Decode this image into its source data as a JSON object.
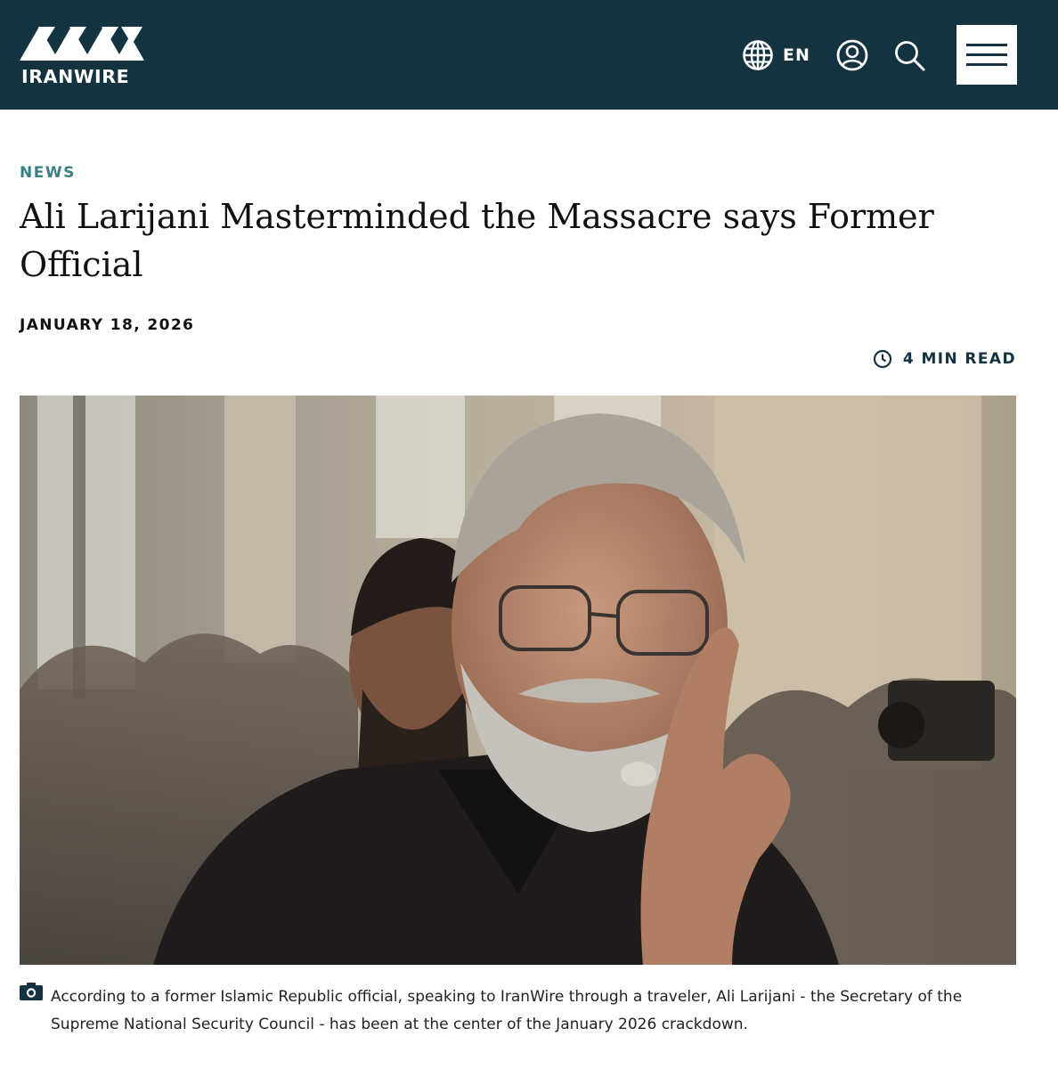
{
  "header": {
    "brand": "IRANWIRE",
    "language": "EN",
    "colors": {
      "bar": "#143340",
      "accent": "#3a7f83"
    },
    "icons": [
      "globe-icon",
      "user-icon",
      "search-icon",
      "hamburger-menu-icon"
    ]
  },
  "article": {
    "category": "NEWS",
    "headline": "Ali Larijani Masterminded the Massacre says Former Official",
    "date": "JANUARY 18, 2026",
    "read_time": "4 MIN READ",
    "caption": "According to a former Islamic Republic official, speaking to IranWire through a traveler, Ali Larijani - the Secretary of the Supreme National Security Council - has been at the center of the January 2026 crackdown.",
    "caption_icon": "camera-icon",
    "clock_icon": "clock-icon"
  }
}
